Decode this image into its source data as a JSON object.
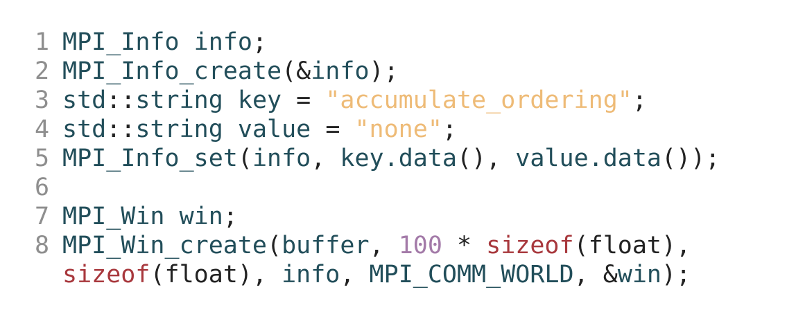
{
  "colors": {
    "identifier": "#224e5a",
    "punctuation": "#222222",
    "string": "#eebb77",
    "number": "#a37aa8",
    "keyword": "#a8383d",
    "line_number": "#8e8e8e",
    "background": "#ffffff"
  },
  "code": {
    "lines": [
      {
        "number": "1",
        "tokens": [
          {
            "text": "MPI_Info info",
            "type": "ident"
          },
          {
            "text": ";",
            "type": "punct"
          }
        ]
      },
      {
        "number": "2",
        "tokens": [
          {
            "text": "MPI_Info_create",
            "type": "ident"
          },
          {
            "text": "(&",
            "type": "punct"
          },
          {
            "text": "info",
            "type": "ident"
          },
          {
            "text": ");",
            "type": "punct"
          }
        ]
      },
      {
        "number": "3",
        "tokens": [
          {
            "text": "std",
            "type": "ident"
          },
          {
            "text": "::",
            "type": "punct"
          },
          {
            "text": "string key ",
            "type": "ident"
          },
          {
            "text": "= ",
            "type": "punct"
          },
          {
            "text": "\"accumulate_ordering\"",
            "type": "string"
          },
          {
            "text": ";",
            "type": "punct"
          }
        ]
      },
      {
        "number": "4",
        "tokens": [
          {
            "text": "std",
            "type": "ident"
          },
          {
            "text": "::",
            "type": "punct"
          },
          {
            "text": "string value ",
            "type": "ident"
          },
          {
            "text": "= ",
            "type": "punct"
          },
          {
            "text": "\"none\"",
            "type": "string"
          },
          {
            "text": ";",
            "type": "punct"
          }
        ]
      },
      {
        "number": "5",
        "tokens": [
          {
            "text": "MPI_Info_set",
            "type": "ident"
          },
          {
            "text": "(",
            "type": "punct"
          },
          {
            "text": "info",
            "type": "ident"
          },
          {
            "text": ", ",
            "type": "punct"
          },
          {
            "text": "key.data",
            "type": "ident"
          },
          {
            "text": "(), ",
            "type": "punct"
          },
          {
            "text": "value.data",
            "type": "ident"
          },
          {
            "text": "());",
            "type": "punct"
          }
        ]
      },
      {
        "number": "6",
        "tokens": []
      },
      {
        "number": "7",
        "tokens": [
          {
            "text": "MPI_Win win",
            "type": "ident"
          },
          {
            "text": ";",
            "type": "punct"
          }
        ]
      },
      {
        "number": "8",
        "tokens": [
          {
            "text": "MPI_Win_create",
            "type": "ident"
          },
          {
            "text": "(",
            "type": "punct"
          },
          {
            "text": "buffer",
            "type": "ident"
          },
          {
            "text": ", ",
            "type": "punct"
          },
          {
            "text": "100",
            "type": "number"
          },
          {
            "text": " * ",
            "type": "punct"
          },
          {
            "text": "sizeof",
            "type": "keyword"
          },
          {
            "text": "(float),",
            "type": "punct"
          }
        ]
      },
      {
        "number": "",
        "tokens": [
          {
            "text": "sizeof",
            "type": "keyword"
          },
          {
            "text": "(float), ",
            "type": "punct"
          },
          {
            "text": "info",
            "type": "ident"
          },
          {
            "text": ", ",
            "type": "punct"
          },
          {
            "text": "MPI_COMM_WORLD",
            "type": "ident"
          },
          {
            "text": ", &",
            "type": "punct"
          },
          {
            "text": "win",
            "type": "ident"
          },
          {
            "text": ");",
            "type": "punct"
          }
        ]
      }
    ]
  }
}
